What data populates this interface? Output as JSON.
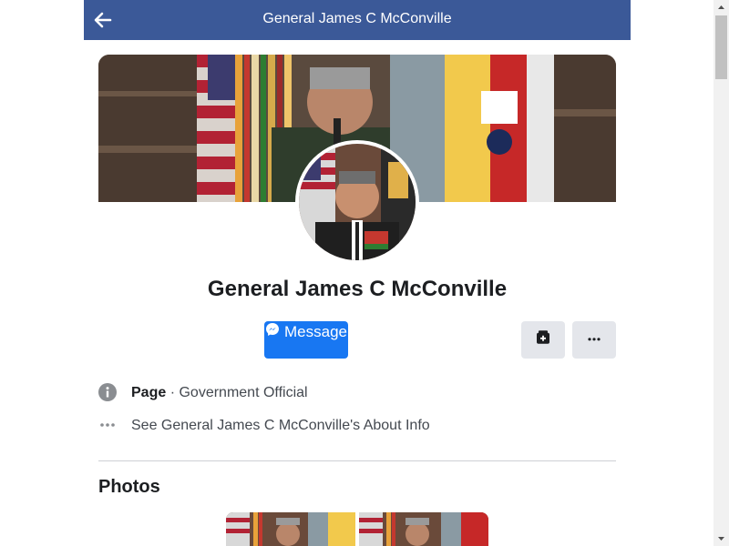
{
  "header": {
    "title": "General James C McConville",
    "back_icon": "arrow-left-icon"
  },
  "profile": {
    "name": "General James C McConville"
  },
  "actions": {
    "message_label": "Message",
    "message_icon": "messenger-icon",
    "save_icon": "save-icon",
    "more_icon": "more-icon",
    "accent_color": "#1877f2"
  },
  "info": {
    "page_label": "Page",
    "separator": "·",
    "category": "Government Official",
    "about_link": "See General James C McConville's About Info"
  },
  "photos": {
    "title": "Photos"
  },
  "colors": {
    "header_bg": "#3b5998",
    "button_gray": "#e4e6eb"
  }
}
